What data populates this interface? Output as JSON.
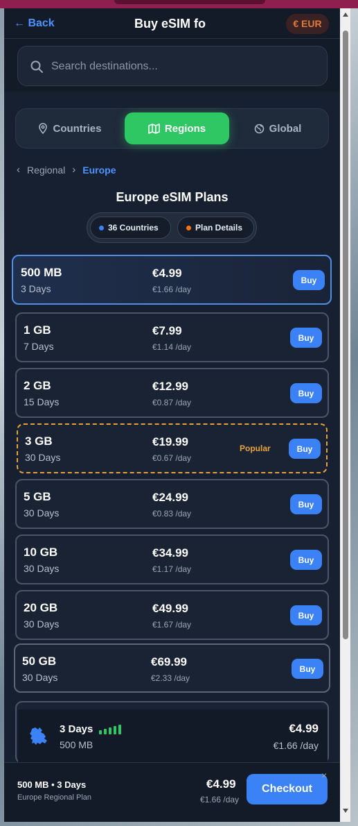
{
  "header": {
    "back_label": "← Back",
    "title": "Buy eSIM fo",
    "currency": "€ EUR"
  },
  "search": {
    "placeholder": "Search destinations..."
  },
  "tabs": [
    {
      "label": "Countries",
      "icon": "map-pin-icon",
      "active": false
    },
    {
      "label": "Regions",
      "icon": "map-icon",
      "active": true
    },
    {
      "label": "Global",
      "icon": "globe-icon",
      "active": false
    }
  ],
  "breadcrumb": {
    "parent": "Regional",
    "current": "Europe"
  },
  "plans_title": "Europe eSIM Plans",
  "pills": [
    {
      "label": "36 Countries",
      "dot_color": "#3b82f6"
    },
    {
      "label": "Plan Details",
      "dot_color": "#f97316"
    }
  ],
  "plans": [
    {
      "data": "500 MB",
      "days": "3 Days",
      "price": "€4.99",
      "per_day": "€1.66 /day",
      "buy": "Buy",
      "badge": ""
    },
    {
      "data": "1 GB",
      "days": "7 Days",
      "price": "€7.99",
      "per_day": "€1.14 /day",
      "buy": "Buy",
      "badge": ""
    },
    {
      "data": "2 GB",
      "days": "15 Days",
      "price": "€12.99",
      "per_day": "€0.87 /day",
      "buy": "Buy",
      "badge": ""
    },
    {
      "data": "3 GB",
      "days": "30 Days",
      "price": "€19.99",
      "per_day": "€0.67 /day",
      "buy": "Buy",
      "badge": "Popular"
    },
    {
      "data": "5 GB",
      "days": "30 Days",
      "price": "€24.99",
      "per_day": "€0.83 /day",
      "buy": "Buy",
      "badge": ""
    },
    {
      "data": "10 GB",
      "days": "30 Days",
      "price": "€34.99",
      "per_day": "€1.17 /day",
      "buy": "Buy",
      "badge": ""
    },
    {
      "data": "20 GB",
      "days": "30 Days",
      "price": "€49.99",
      "per_day": "€1.67 /day",
      "buy": "Buy",
      "badge": ""
    },
    {
      "data": "50 GB",
      "days": "30 Days",
      "price": "€69.99",
      "per_day": "€2.33 /day",
      "buy": "Buy",
      "badge": ""
    }
  ],
  "selected_summary": {
    "days": "3 Days",
    "data": "500 MB",
    "price": "€4.99",
    "per_day": "€1.66 /day"
  },
  "footer": {
    "plan": "500 MB • 3 Days",
    "subtitle": "Europe Regional Plan",
    "price": "€4.99",
    "per_day": "€1.66 /day",
    "checkout_label": "Checkout",
    "close_label": "×"
  },
  "colors": {
    "accent": "#3b82f6",
    "active_tab": "#2fc764",
    "popular": "#e9a23b"
  }
}
